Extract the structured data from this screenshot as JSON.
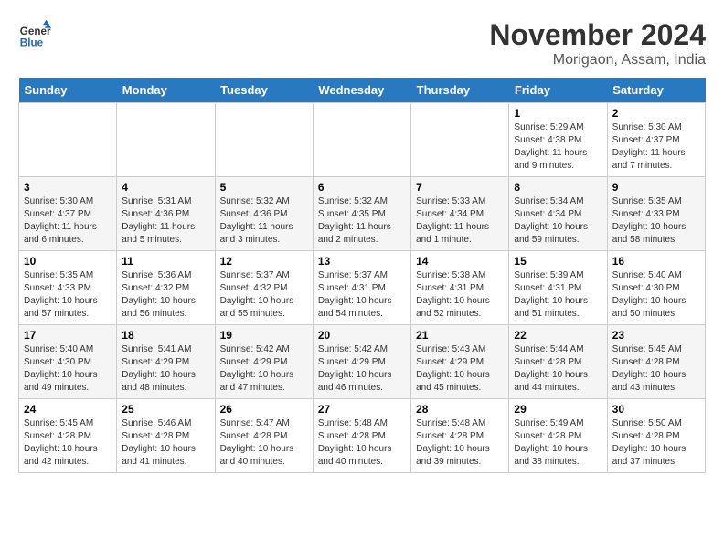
{
  "logo": {
    "text_general": "General",
    "text_blue": "Blue"
  },
  "title": "November 2024",
  "location": "Morigaon, Assam, India",
  "weekdays": [
    "Sunday",
    "Monday",
    "Tuesday",
    "Wednesday",
    "Thursday",
    "Friday",
    "Saturday"
  ],
  "weeks": [
    [
      {
        "day": "",
        "sunrise": "",
        "sunset": "",
        "daylight": ""
      },
      {
        "day": "",
        "sunrise": "",
        "sunset": "",
        "daylight": ""
      },
      {
        "day": "",
        "sunrise": "",
        "sunset": "",
        "daylight": ""
      },
      {
        "day": "",
        "sunrise": "",
        "sunset": "",
        "daylight": ""
      },
      {
        "day": "",
        "sunrise": "",
        "sunset": "",
        "daylight": ""
      },
      {
        "day": "1",
        "sunrise": "Sunrise: 5:29 AM",
        "sunset": "Sunset: 4:38 PM",
        "daylight": "Daylight: 11 hours and 9 minutes."
      },
      {
        "day": "2",
        "sunrise": "Sunrise: 5:30 AM",
        "sunset": "Sunset: 4:37 PM",
        "daylight": "Daylight: 11 hours and 7 minutes."
      }
    ],
    [
      {
        "day": "3",
        "sunrise": "Sunrise: 5:30 AM",
        "sunset": "Sunset: 4:37 PM",
        "daylight": "Daylight: 11 hours and 6 minutes."
      },
      {
        "day": "4",
        "sunrise": "Sunrise: 5:31 AM",
        "sunset": "Sunset: 4:36 PM",
        "daylight": "Daylight: 11 hours and 5 minutes."
      },
      {
        "day": "5",
        "sunrise": "Sunrise: 5:32 AM",
        "sunset": "Sunset: 4:36 PM",
        "daylight": "Daylight: 11 hours and 3 minutes."
      },
      {
        "day": "6",
        "sunrise": "Sunrise: 5:32 AM",
        "sunset": "Sunset: 4:35 PM",
        "daylight": "Daylight: 11 hours and 2 minutes."
      },
      {
        "day": "7",
        "sunrise": "Sunrise: 5:33 AM",
        "sunset": "Sunset: 4:34 PM",
        "daylight": "Daylight: 11 hours and 1 minute."
      },
      {
        "day": "8",
        "sunrise": "Sunrise: 5:34 AM",
        "sunset": "Sunset: 4:34 PM",
        "daylight": "Daylight: 10 hours and 59 minutes."
      },
      {
        "day": "9",
        "sunrise": "Sunrise: 5:35 AM",
        "sunset": "Sunset: 4:33 PM",
        "daylight": "Daylight: 10 hours and 58 minutes."
      }
    ],
    [
      {
        "day": "10",
        "sunrise": "Sunrise: 5:35 AM",
        "sunset": "Sunset: 4:33 PM",
        "daylight": "Daylight: 10 hours and 57 minutes."
      },
      {
        "day": "11",
        "sunrise": "Sunrise: 5:36 AM",
        "sunset": "Sunset: 4:32 PM",
        "daylight": "Daylight: 10 hours and 56 minutes."
      },
      {
        "day": "12",
        "sunrise": "Sunrise: 5:37 AM",
        "sunset": "Sunset: 4:32 PM",
        "daylight": "Daylight: 10 hours and 55 minutes."
      },
      {
        "day": "13",
        "sunrise": "Sunrise: 5:37 AM",
        "sunset": "Sunset: 4:31 PM",
        "daylight": "Daylight: 10 hours and 54 minutes."
      },
      {
        "day": "14",
        "sunrise": "Sunrise: 5:38 AM",
        "sunset": "Sunset: 4:31 PM",
        "daylight": "Daylight: 10 hours and 52 minutes."
      },
      {
        "day": "15",
        "sunrise": "Sunrise: 5:39 AM",
        "sunset": "Sunset: 4:31 PM",
        "daylight": "Daylight: 10 hours and 51 minutes."
      },
      {
        "day": "16",
        "sunrise": "Sunrise: 5:40 AM",
        "sunset": "Sunset: 4:30 PM",
        "daylight": "Daylight: 10 hours and 50 minutes."
      }
    ],
    [
      {
        "day": "17",
        "sunrise": "Sunrise: 5:40 AM",
        "sunset": "Sunset: 4:30 PM",
        "daylight": "Daylight: 10 hours and 49 minutes."
      },
      {
        "day": "18",
        "sunrise": "Sunrise: 5:41 AM",
        "sunset": "Sunset: 4:29 PM",
        "daylight": "Daylight: 10 hours and 48 minutes."
      },
      {
        "day": "19",
        "sunrise": "Sunrise: 5:42 AM",
        "sunset": "Sunset: 4:29 PM",
        "daylight": "Daylight: 10 hours and 47 minutes."
      },
      {
        "day": "20",
        "sunrise": "Sunrise: 5:42 AM",
        "sunset": "Sunset: 4:29 PM",
        "daylight": "Daylight: 10 hours and 46 minutes."
      },
      {
        "day": "21",
        "sunrise": "Sunrise: 5:43 AM",
        "sunset": "Sunset: 4:29 PM",
        "daylight": "Daylight: 10 hours and 45 minutes."
      },
      {
        "day": "22",
        "sunrise": "Sunrise: 5:44 AM",
        "sunset": "Sunset: 4:28 PM",
        "daylight": "Daylight: 10 hours and 44 minutes."
      },
      {
        "day": "23",
        "sunrise": "Sunrise: 5:45 AM",
        "sunset": "Sunset: 4:28 PM",
        "daylight": "Daylight: 10 hours and 43 minutes."
      }
    ],
    [
      {
        "day": "24",
        "sunrise": "Sunrise: 5:45 AM",
        "sunset": "Sunset: 4:28 PM",
        "daylight": "Daylight: 10 hours and 42 minutes."
      },
      {
        "day": "25",
        "sunrise": "Sunrise: 5:46 AM",
        "sunset": "Sunset: 4:28 PM",
        "daylight": "Daylight: 10 hours and 41 minutes."
      },
      {
        "day": "26",
        "sunrise": "Sunrise: 5:47 AM",
        "sunset": "Sunset: 4:28 PM",
        "daylight": "Daylight: 10 hours and 40 minutes."
      },
      {
        "day": "27",
        "sunrise": "Sunrise: 5:48 AM",
        "sunset": "Sunset: 4:28 PM",
        "daylight": "Daylight: 10 hours and 40 minutes."
      },
      {
        "day": "28",
        "sunrise": "Sunrise: 5:48 AM",
        "sunset": "Sunset: 4:28 PM",
        "daylight": "Daylight: 10 hours and 39 minutes."
      },
      {
        "day": "29",
        "sunrise": "Sunrise: 5:49 AM",
        "sunset": "Sunset: 4:28 PM",
        "daylight": "Daylight: 10 hours and 38 minutes."
      },
      {
        "day": "30",
        "sunrise": "Sunrise: 5:50 AM",
        "sunset": "Sunset: 4:28 PM",
        "daylight": "Daylight: 10 hours and 37 minutes."
      }
    ]
  ]
}
